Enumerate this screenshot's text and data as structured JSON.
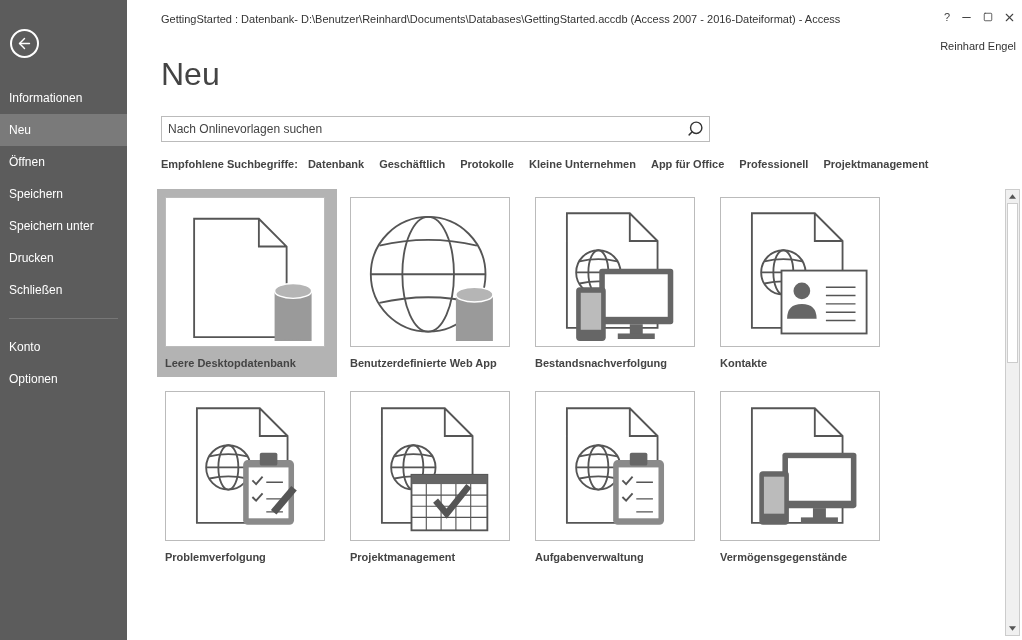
{
  "window": {
    "title": "GettingStarted : Datenbank- D:\\Benutzer\\Reinhard\\Documents\\Databases\\GettingStarted.accdb (Access 2007 - 2016-Dateiformat) - Access",
    "help": "?",
    "user": "Reinhard Engel"
  },
  "sidebar": {
    "items": [
      {
        "label": "Informationen",
        "selected": false
      },
      {
        "label": "Neu",
        "selected": true
      },
      {
        "label": "Öffnen",
        "selected": false
      },
      {
        "label": "Speichern",
        "selected": false
      },
      {
        "label": "Speichern unter",
        "selected": false
      },
      {
        "label": "Drucken",
        "selected": false
      },
      {
        "label": "Schließen",
        "selected": false
      }
    ],
    "footer_items": [
      {
        "label": "Konto",
        "selected": false
      },
      {
        "label": "Optionen",
        "selected": false
      }
    ]
  },
  "heading": "Neu",
  "search": {
    "placeholder": "Nach Onlinevorlagen suchen"
  },
  "suggestions": {
    "label": "Empfohlene Suchbegriffe:",
    "terms": [
      "Datenbank",
      "Geschäftlich",
      "Protokolle",
      "Kleine Unternehmen",
      "App für Office",
      "Professionell",
      "Projektmanagement"
    ]
  },
  "templates": [
    {
      "kind": "blank-db",
      "label": "Leere Desktopdatenbank",
      "selected": true
    },
    {
      "kind": "web-db",
      "label": "Benutzerdefinierte Web App",
      "selected": false
    },
    {
      "kind": "devices-doc",
      "label": "Bestandsnachverfolgung",
      "selected": false
    },
    {
      "kind": "contact",
      "label": "Kontakte",
      "selected": false
    },
    {
      "kind": "issue",
      "label": "Problemverfolgung",
      "selected": false
    },
    {
      "kind": "project",
      "label": "Projektmanagement",
      "selected": false
    },
    {
      "kind": "task",
      "label": "Aufgabenverwaltung",
      "selected": false
    },
    {
      "kind": "devices",
      "label": "Vermögensgegenstände",
      "selected": false
    }
  ]
}
